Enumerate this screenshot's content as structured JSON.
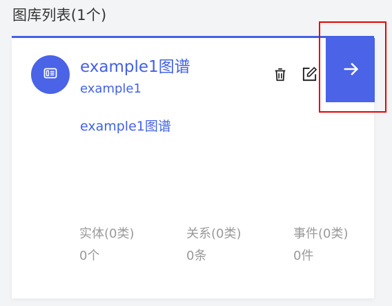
{
  "section": {
    "title": "图库列表(1个)"
  },
  "card": {
    "title": "example1图谱",
    "subtitle": "example1",
    "description": "example1图谱",
    "stats": [
      {
        "label": "实体(0类)",
        "value": "0个"
      },
      {
        "label": "关系(0类)",
        "value": "0条"
      },
      {
        "label": "事件(0类)",
        "value": "0件"
      }
    ]
  },
  "colors": {
    "accent": "#4361e6",
    "button": "#4a63e7",
    "highlight": "#e60000",
    "muted_text": "#999999"
  },
  "icons": {
    "avatar": "graph-card-icon",
    "delete": "trash-icon",
    "edit": "edit-icon",
    "enter": "arrow-right-icon"
  }
}
